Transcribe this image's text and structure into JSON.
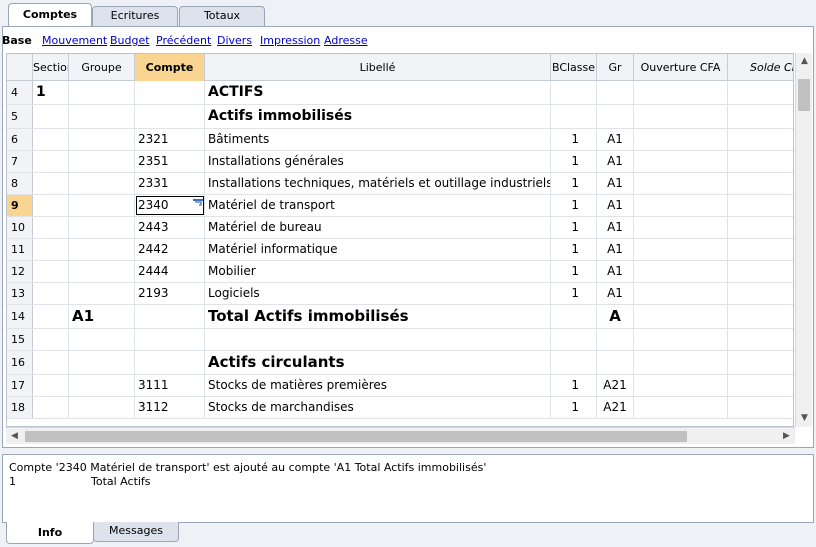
{
  "top_tabs": [
    "Comptes",
    "Ecritures",
    "Totaux"
  ],
  "views": {
    "active": "Base",
    "links": [
      "Mouvement",
      "Budget",
      "Précédent",
      "Divers",
      "Impression",
      "Adresse"
    ]
  },
  "columns": [
    "Section",
    "Groupe",
    "Compte",
    "Libellé",
    "BClasse",
    "Gr",
    "Ouverture CFA",
    "Solde CFA"
  ],
  "rows": [
    {
      "n": "4",
      "section": "1",
      "groupe": "",
      "compte": "",
      "libelle": "ACTIFS",
      "bclasse": "",
      "gr": ""
    },
    {
      "n": "5",
      "section": "",
      "groupe": "",
      "compte": "",
      "libelle": "Actifs immobilisés",
      "bclasse": "",
      "gr": ""
    },
    {
      "n": "6",
      "section": "",
      "groupe": "",
      "compte": "2321",
      "libelle": "Bâtiments",
      "bclasse": "1",
      "gr": "A1"
    },
    {
      "n": "7",
      "section": "",
      "groupe": "",
      "compte": "2351",
      "libelle": "Installations générales",
      "bclasse": "1",
      "gr": "A1"
    },
    {
      "n": "8",
      "section": "",
      "groupe": "",
      "compte": "2331",
      "libelle": "Installations techniques, matériels et outillage industriels",
      "bclasse": "1",
      "gr": "A1"
    },
    {
      "n": "9",
      "section": "",
      "groupe": "",
      "compte": "2340",
      "libelle": "Matériel de transport",
      "bclasse": "1",
      "gr": "A1"
    },
    {
      "n": "10",
      "section": "",
      "groupe": "",
      "compte": "2443",
      "libelle": "Matériel de bureau",
      "bclasse": "1",
      "gr": "A1"
    },
    {
      "n": "11",
      "section": "",
      "groupe": "",
      "compte": "2442",
      "libelle": "Matériel informatique",
      "bclasse": "1",
      "gr": "A1"
    },
    {
      "n": "12",
      "section": "",
      "groupe": "",
      "compte": "2444",
      "libelle": "Mobilier",
      "bclasse": "1",
      "gr": "A1"
    },
    {
      "n": "13",
      "section": "",
      "groupe": "",
      "compte": "2193",
      "libelle": "Logiciels",
      "bclasse": "1",
      "gr": "A1"
    },
    {
      "n": "14",
      "section": "",
      "groupe": "A1",
      "compte": "",
      "libelle": "Total Actifs immobilisés",
      "bclasse": "",
      "gr": "A"
    },
    {
      "n": "15",
      "section": "",
      "groupe": "",
      "compte": "",
      "libelle": "",
      "bclasse": "",
      "gr": ""
    },
    {
      "n": "16",
      "section": "",
      "groupe": "",
      "compte": "",
      "libelle": "Actifs circulants",
      "bclasse": "",
      "gr": ""
    },
    {
      "n": "17",
      "section": "",
      "groupe": "",
      "compte": "3111",
      "libelle": "Stocks de matières premières",
      "bclasse": "1",
      "gr": "A21"
    },
    {
      "n": "18",
      "section": "",
      "groupe": "",
      "compte": "3112",
      "libelle": "Stocks de marchandises",
      "bclasse": "1",
      "gr": "A21"
    }
  ],
  "current_row": "9",
  "info": {
    "message": "Compte '2340 Matériel de transport' est ajouté au compte 'A1 Total Actifs immobilisés'",
    "line2_number": "1",
    "line2_text": "Total Actifs"
  },
  "bottom_tabs": [
    "Info",
    "Messages"
  ]
}
